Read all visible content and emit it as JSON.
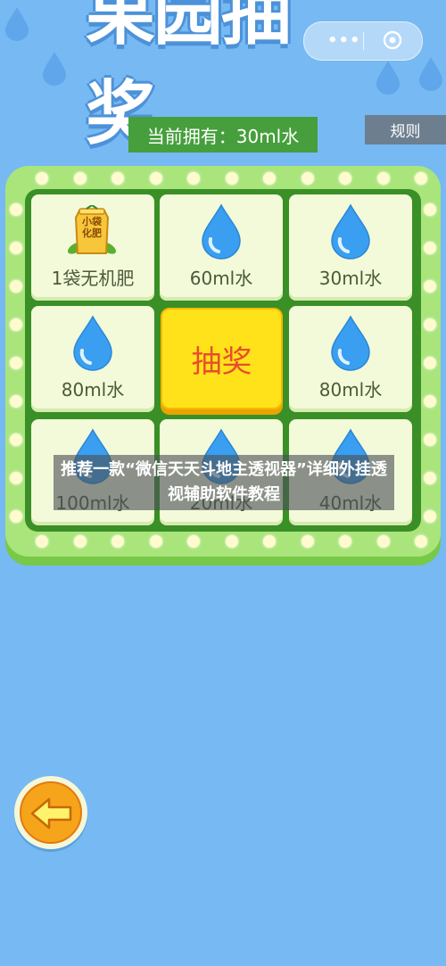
{
  "header": {
    "title": "果园抽奖",
    "balance_text": "当前拥有：30ml水",
    "rules_label": "规则",
    "capsule_menu_icon": "more-dots-icon",
    "capsule_close_icon": "target-circle-icon"
  },
  "prizes": [
    {
      "label": "1袋无机肥",
      "icon": "fertilizer-bag-icon",
      "badge": "小袋\n化肥"
    },
    {
      "label": "60ml水",
      "icon": "water-drop-icon"
    },
    {
      "label": "30ml水",
      "icon": "water-drop-icon"
    },
    {
      "label": "80ml水",
      "icon": "water-drop-icon"
    },
    {
      "label": "80ml水",
      "icon": "water-drop-icon"
    },
    {
      "label": "100ml水",
      "icon": "water-drop-icon"
    },
    {
      "label": "20ml水",
      "icon": "water-drop-icon"
    },
    {
      "label": "40ml水",
      "icon": "water-drop-icon"
    }
  ],
  "draw_button_label": "抽奖",
  "overlay_banner": "推荐一款“微信天天斗地主透视器”详细外挂透视辅助软件教程",
  "back_button_icon": "back-arrow-icon",
  "colors": {
    "background": "#77b9f3",
    "board": "#a9e57b",
    "board_inner": "#3a8f26",
    "draw_button": "#ffe21a",
    "draw_text": "#e84d2c",
    "balance_bg": "#469f3c",
    "rules_bg": "#6d7f8f"
  }
}
